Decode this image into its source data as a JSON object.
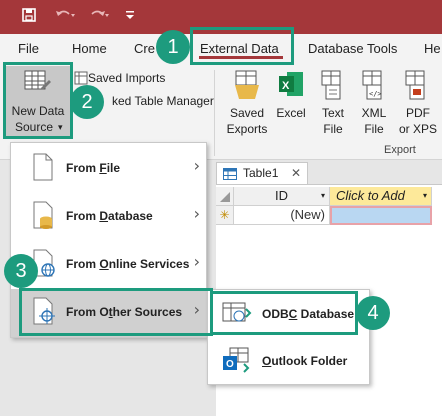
{
  "quick_access": {
    "save_icon": "save-icon",
    "undo_icon": "undo-icon",
    "redo_icon": "redo-icon",
    "customize_icon": "customize-icon"
  },
  "tabs": [
    {
      "label": "File"
    },
    {
      "label": "Home"
    },
    {
      "label": "Cre"
    },
    {
      "label": "External Data"
    },
    {
      "label": "Database Tools"
    },
    {
      "label": "He"
    }
  ],
  "ribbon": {
    "new_data_source": {
      "line1": "New Data",
      "line2": "Source",
      "caret": "▾"
    },
    "saved_imports": "Saved Imports",
    "linked_table_manager": "ked Table Manager",
    "export_buttons": [
      {
        "line1": "Saved",
        "line2": "Exports"
      },
      {
        "line1": "Excel",
        "line2": ""
      },
      {
        "line1": "Text",
        "line2": "File"
      },
      {
        "line1": "XML",
        "line2": "File"
      },
      {
        "line1": "PDF",
        "line2": "or XPS"
      }
    ],
    "export_group_label": "Export"
  },
  "table": {
    "tab_label": "Table1",
    "close_glyph": "✕",
    "columns": [
      "ID",
      "Click to Add"
    ],
    "new_row_marker": "✳",
    "new_row_value": "(New)"
  },
  "menu": {
    "items": [
      {
        "pre": "From ",
        "key": "F",
        "post": "ile"
      },
      {
        "pre": "From ",
        "key": "D",
        "post": "atabase"
      },
      {
        "pre": "From ",
        "key": "O",
        "post": "nline Services"
      },
      {
        "pre": "From O",
        "key": "t",
        "post": "her Sources"
      }
    ],
    "chevron": "›"
  },
  "submenu": {
    "items": [
      {
        "pre": "ODB",
        "key": "C",
        "post": " Database"
      },
      {
        "pre": "",
        "key": "O",
        "post": "utlook Folder"
      }
    ]
  },
  "steps": [
    "1",
    "2",
    "3",
    "4"
  ],
  "colors": {
    "title_bar": "#a4373a",
    "accent": "#1d9b7e",
    "selection": "#b9d7f2"
  }
}
